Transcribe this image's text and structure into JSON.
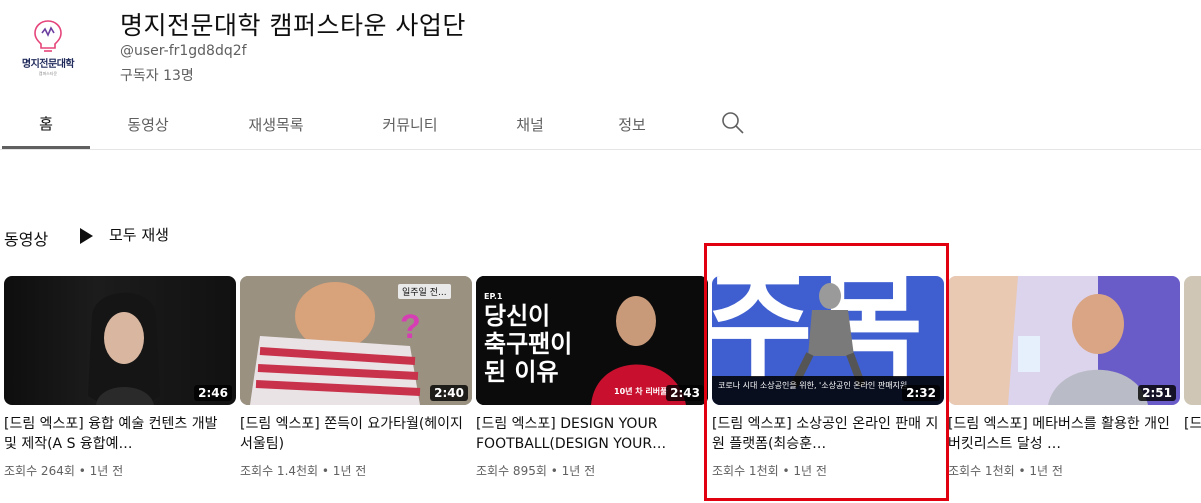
{
  "channel": {
    "logo_text": "명지전문대학",
    "logo_sub": "캠퍼스타운",
    "title": "명지전문대학 캠퍼스타운 사업단",
    "handle": "@user-fr1gd8dq2f",
    "subscribers": "구독자 13명"
  },
  "tabs": [
    {
      "label": "홈"
    },
    {
      "label": "동영상"
    },
    {
      "label": "재생목록"
    },
    {
      "label": "커뮤니티"
    },
    {
      "label": "채널"
    },
    {
      "label": "정보"
    }
  ],
  "section": {
    "title": "동영상",
    "play_all": "모두 재생"
  },
  "videos": [
    {
      "title": "[드림 엑스포] 융합 예술 컨텐츠 개발 및 제작(A S 융합예…",
      "meta": "조회수 264회 • 1년 전",
      "duration": "2:46"
    },
    {
      "title": "[드림 엑스포] 쫀득이 요가타월(헤이지서울팀)",
      "meta": "조회수 1.4천회 • 1년 전",
      "duration": "2:40",
      "overlay_a": "일주일 전...",
      "overlay_b": "?"
    },
    {
      "title": "[드림 엑스포] DESIGN YOUR FOOTBALL(DESIGN YOUR…",
      "meta": "조회수 895회 • 1년 전",
      "duration": "2:43",
      "overlay_a": "당신이",
      "overlay_b": "축구팬이",
      "overlay_c": "된 이유",
      "overlay_d": "10년 차 리버풀",
      "overlay_e": "EP.1"
    },
    {
      "title": "[드림 엑스포] 소상공인 온라인 판매 지원 플랫폼(최승훈…",
      "meta": "조회수 1천회 • 1년 전",
      "duration": "2:32",
      "overlay_a": "주목",
      "overlay_b": "코로나 시대 소상공인을 위한, '소상공인 온라인 판매지원"
    },
    {
      "title": "[드림 엑스포] 메타버스를 활용한 개인 버킷리스트 달성 …",
      "meta": "조회수 1천회 • 1년 전",
      "duration": "2:51"
    },
    {
      "title": "[드",
      "meta": "",
      "duration": ""
    }
  ]
}
